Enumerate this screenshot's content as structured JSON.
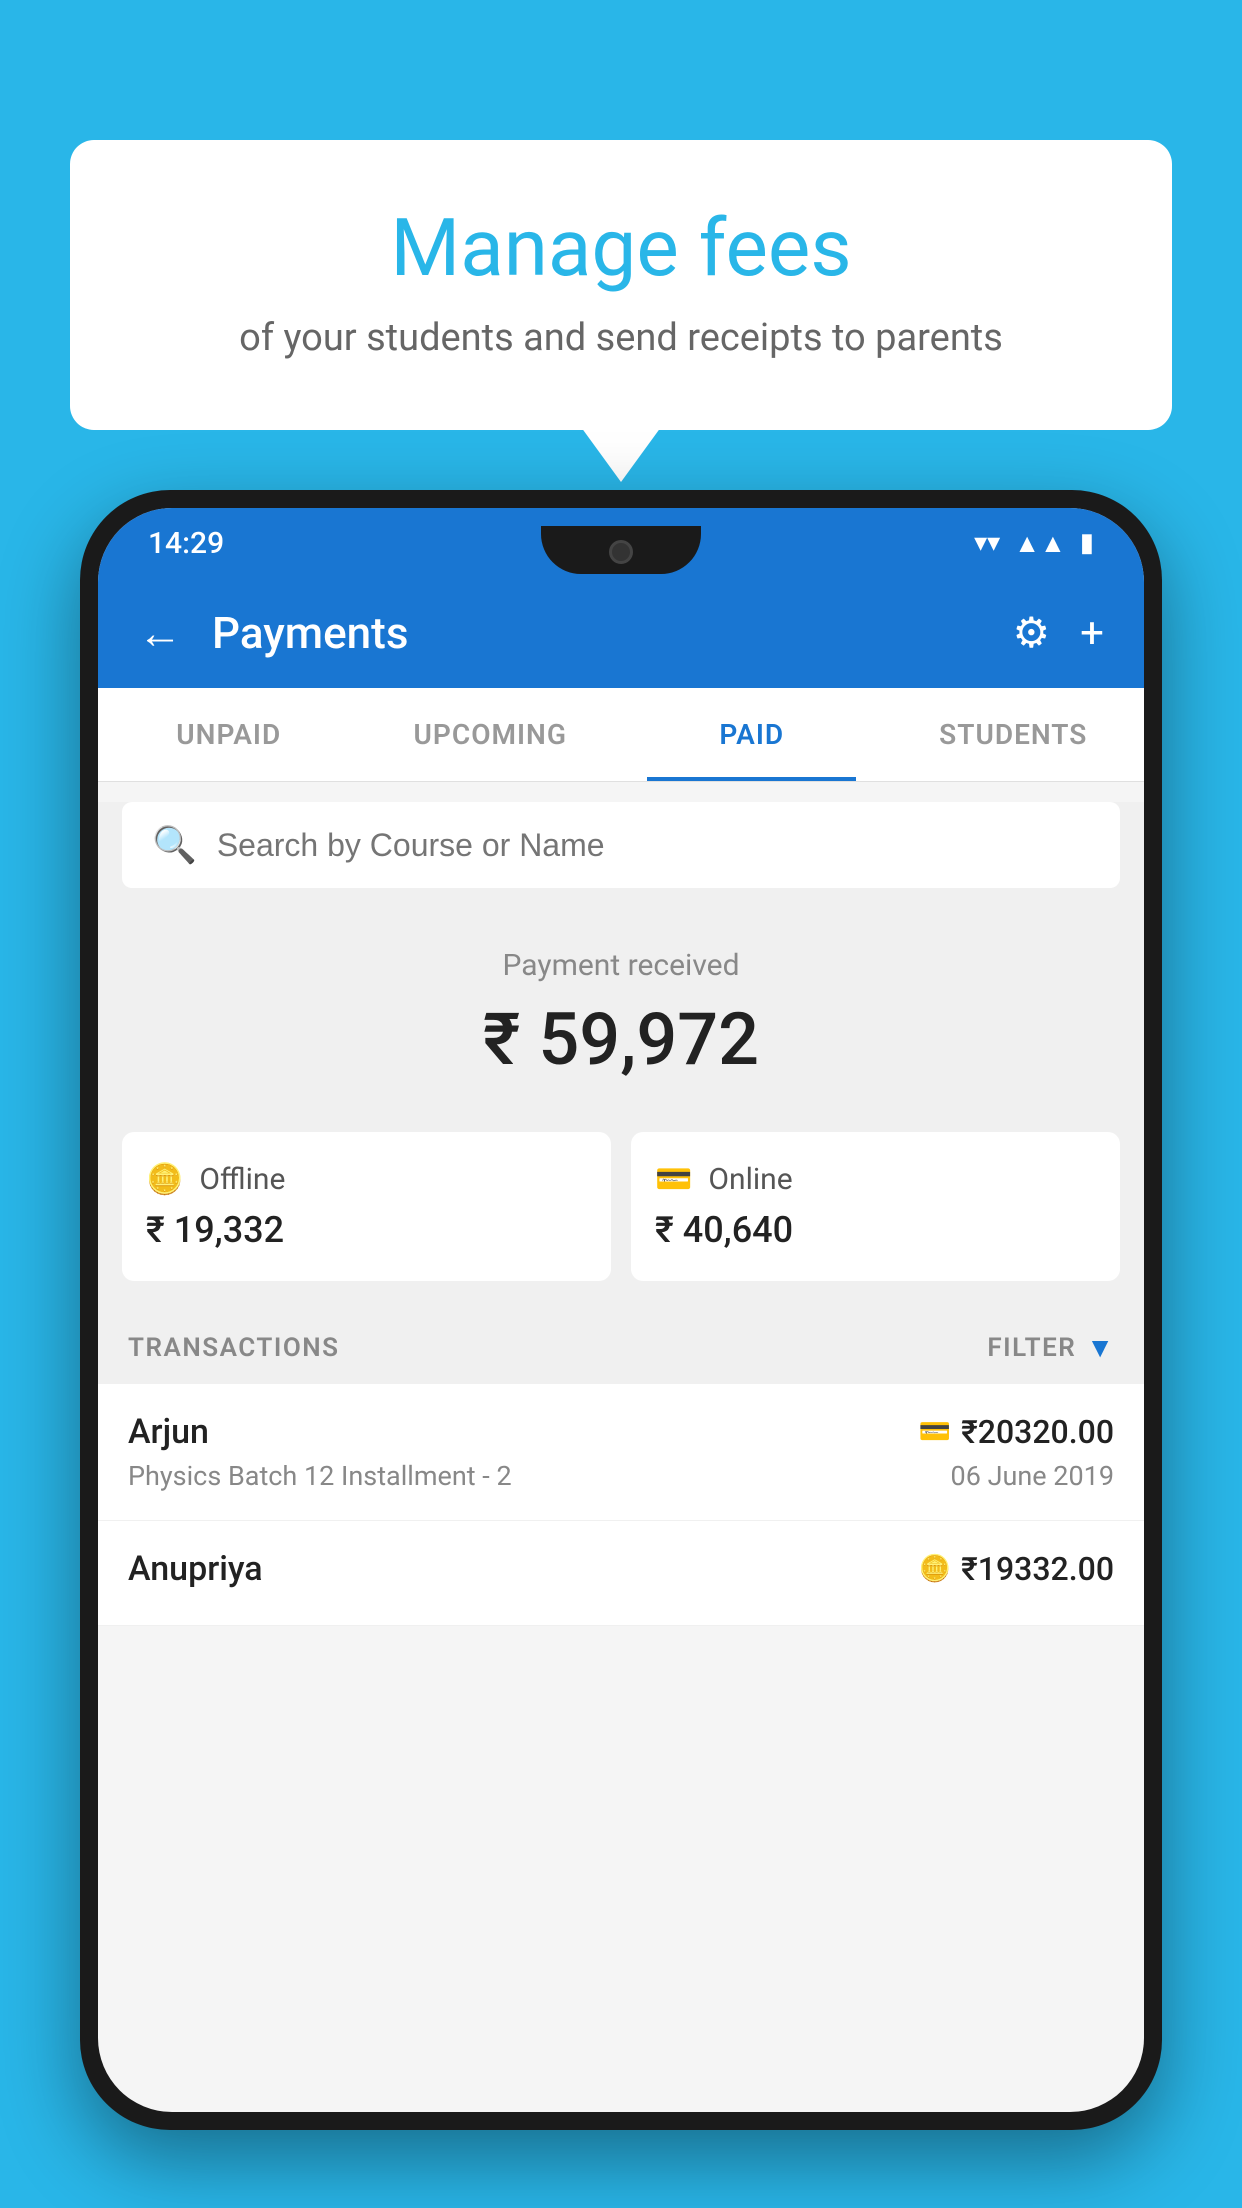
{
  "background_color": "#29b6e8",
  "speech_bubble": {
    "title": "Manage fees",
    "subtitle": "of your students and send receipts to parents"
  },
  "phone": {
    "status_bar": {
      "time": "14:29",
      "icons": [
        "wifi",
        "signal",
        "battery"
      ]
    },
    "app_bar": {
      "title": "Payments",
      "back_label": "←",
      "settings_label": "⚙",
      "add_label": "+"
    },
    "tabs": [
      {
        "label": "UNPAID",
        "active": false
      },
      {
        "label": "UPCOMING",
        "active": false
      },
      {
        "label": "PAID",
        "active": true
      },
      {
        "label": "STUDENTS",
        "active": false
      }
    ],
    "search": {
      "placeholder": "Search by Course or Name"
    },
    "payment_received": {
      "label": "Payment received",
      "amount": "₹ 59,972"
    },
    "payment_cards": [
      {
        "icon": "offline",
        "label": "Offline",
        "amount": "₹ 19,332"
      },
      {
        "icon": "online",
        "label": "Online",
        "amount": "₹ 40,640"
      }
    ],
    "transactions": {
      "header_label": "TRANSACTIONS",
      "filter_label": "FILTER",
      "items": [
        {
          "name": "Arjun",
          "course": "Physics Batch 12 Installment - 2",
          "amount": "₹20320.00",
          "date": "06 June 2019",
          "type": "online"
        },
        {
          "name": "Anupriya",
          "course": "",
          "amount": "₹19332.00",
          "date": "",
          "type": "offline"
        }
      ]
    }
  }
}
